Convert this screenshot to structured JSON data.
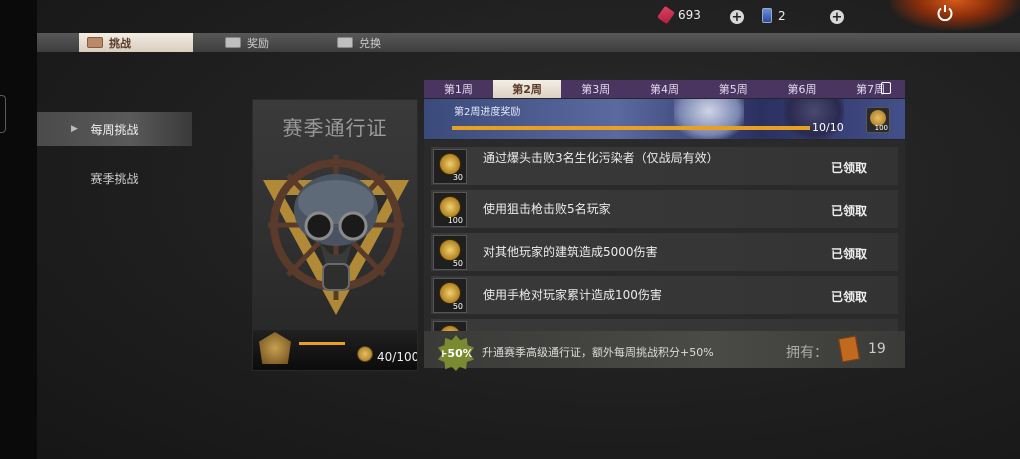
{
  "header": {
    "ticket_count": "693",
    "card_count": "2",
    "plus_label": "+"
  },
  "tabs": [
    {
      "label": "挑战"
    },
    {
      "label": "奖励"
    },
    {
      "label": "兑换"
    }
  ],
  "sidebar": {
    "items": [
      {
        "label": "每周挑战"
      },
      {
        "label": "赛季挑战"
      }
    ]
  },
  "pass_card": {
    "title": "赛季通行证",
    "points": "40/100",
    "progress": 0.4
  },
  "weeks": [
    {
      "label": "第1周"
    },
    {
      "label": "第2周"
    },
    {
      "label": "第3周"
    },
    {
      "label": "第4周"
    },
    {
      "label": "第5周"
    },
    {
      "label": "第6周"
    },
    {
      "label": "第7周"
    }
  ],
  "banner": {
    "title": "第2周进度奖励",
    "progress_text": "10/10",
    "progress": 1.0,
    "reward_qty": "100"
  },
  "tasks": [
    {
      "desc": "通过爆头击败3名生化污染者（仅战局有效）",
      "qty": "30",
      "status": "已领取"
    },
    {
      "desc": "使用狙击枪击败5名玩家",
      "qty": "100",
      "status": "已领取"
    },
    {
      "desc": "对其他玩家的建筑造成5000伤害",
      "qty": "50",
      "status": "已领取"
    },
    {
      "desc": "使用手枪对玩家累计造成100伤害",
      "qty": "50",
      "status": "已领取"
    }
  ],
  "bottom": {
    "bonus_badge": "+50%",
    "bonus_text": "升通赛季高级通行证，额外每周挑战积分+50%",
    "own_label": "拥有：",
    "own_count": "19"
  }
}
